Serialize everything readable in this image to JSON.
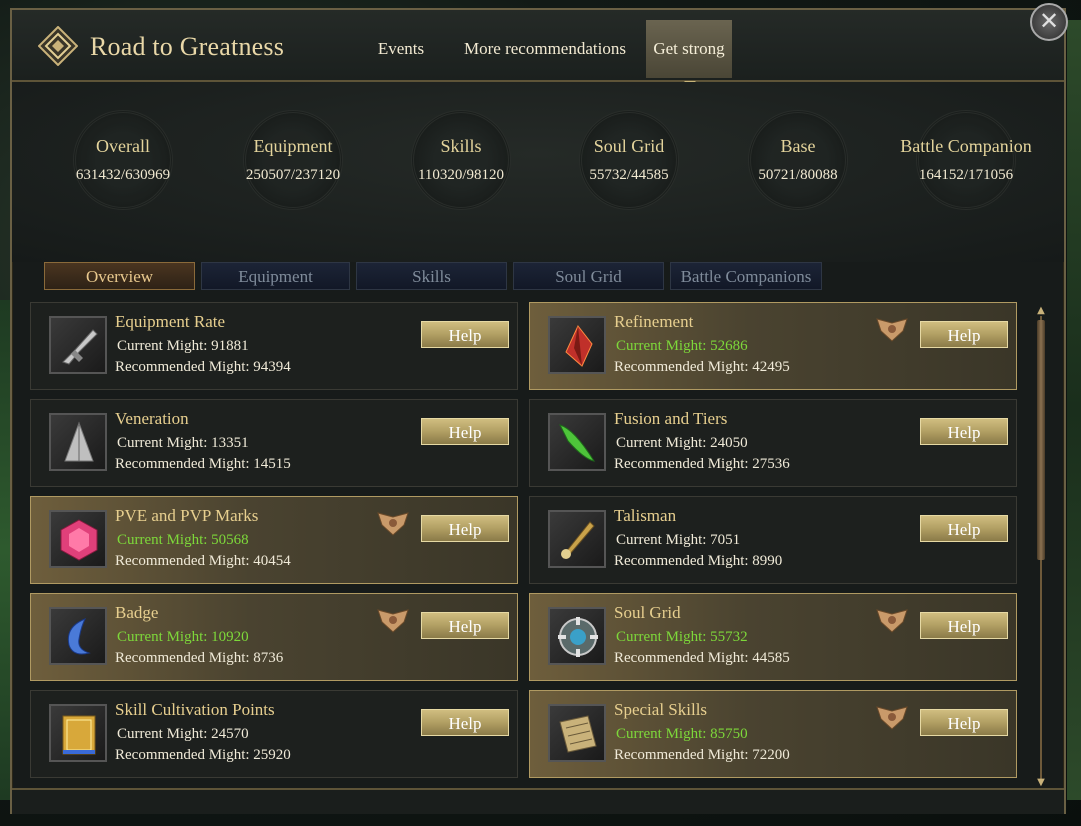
{
  "header": {
    "title": "Road to Greatness",
    "tabs": [
      {
        "label": "Events",
        "active": false
      },
      {
        "label": "More recommendations",
        "active": false
      },
      {
        "label": "Get strong",
        "active": true
      }
    ],
    "close_label": "✕"
  },
  "stats": [
    {
      "label": "Overall",
      "value": "631432/630969"
    },
    {
      "label": "Equipment",
      "value": "250507/237120"
    },
    {
      "label": "Skills",
      "value": "110320/98120"
    },
    {
      "label": "Soul Grid",
      "value": "55732/44585"
    },
    {
      "label": "Base",
      "value": "50721/80088"
    },
    {
      "label": "Battle Companion",
      "value": "164152/171056"
    }
  ],
  "subtabs": [
    {
      "label": "Overview",
      "active": true
    },
    {
      "label": "Equipment",
      "active": false
    },
    {
      "label": "Skills",
      "active": false
    },
    {
      "label": "Soul Grid",
      "active": false
    },
    {
      "label": "Battle Companions",
      "active": false
    }
  ],
  "cards": [
    {
      "name": "Equipment Rate",
      "current": "Current Might: 91881",
      "recommended": "Recommended Might: 94394",
      "help": "Help",
      "icon": "blade-icon"
    },
    {
      "name": "Refinement",
      "current": "Current Might: 52686",
      "recommended": "Recommended Might: 42495",
      "help": "Help",
      "icon": "crystal-icon"
    },
    {
      "name": "Veneration",
      "current": "Current Might: 13351",
      "recommended": "Recommended Might: 14515",
      "help": "Help",
      "icon": "silver-crest-icon"
    },
    {
      "name": "Fusion and Tiers",
      "current": "Current Might: 24050",
      "recommended": "Recommended Might: 27536",
      "help": "Help",
      "icon": "green-horn-icon"
    },
    {
      "name": "PVE and PVP Marks",
      "current": "Current Might: 50568",
      "recommended": "Recommended Might: 40454",
      "help": "Help",
      "icon": "pink-gem-icon"
    },
    {
      "name": "Talisman",
      "current": "Current Might: 7051",
      "recommended": "Recommended Might: 8990",
      "help": "Help",
      "icon": "talisman-icon"
    },
    {
      "name": "Badge",
      "current": "Current Might: 10920",
      "recommended": "Recommended Might: 8736",
      "help": "Help",
      "icon": "blue-swirl-icon"
    },
    {
      "name": "Soul Grid",
      "current": "Current Might: 55732",
      "recommended": "Recommended Might: 44585",
      "help": "Help",
      "icon": "soul-disc-icon"
    },
    {
      "name": "Skill Cultivation Points",
      "current": "Current Might: 24570",
      "recommended": "Recommended Might: 25920",
      "help": "Help",
      "icon": "golden-book-icon"
    },
    {
      "name": "Special Skills",
      "current": "Current Might: 85750",
      "recommended": "Recommended Might: 72200",
      "help": "Help",
      "icon": "scroll-icon"
    }
  ],
  "colors": {
    "accent_gold": "#e7cf8f",
    "above_recommendation_green": "#7dd83a",
    "help_button": "#b19f63"
  }
}
